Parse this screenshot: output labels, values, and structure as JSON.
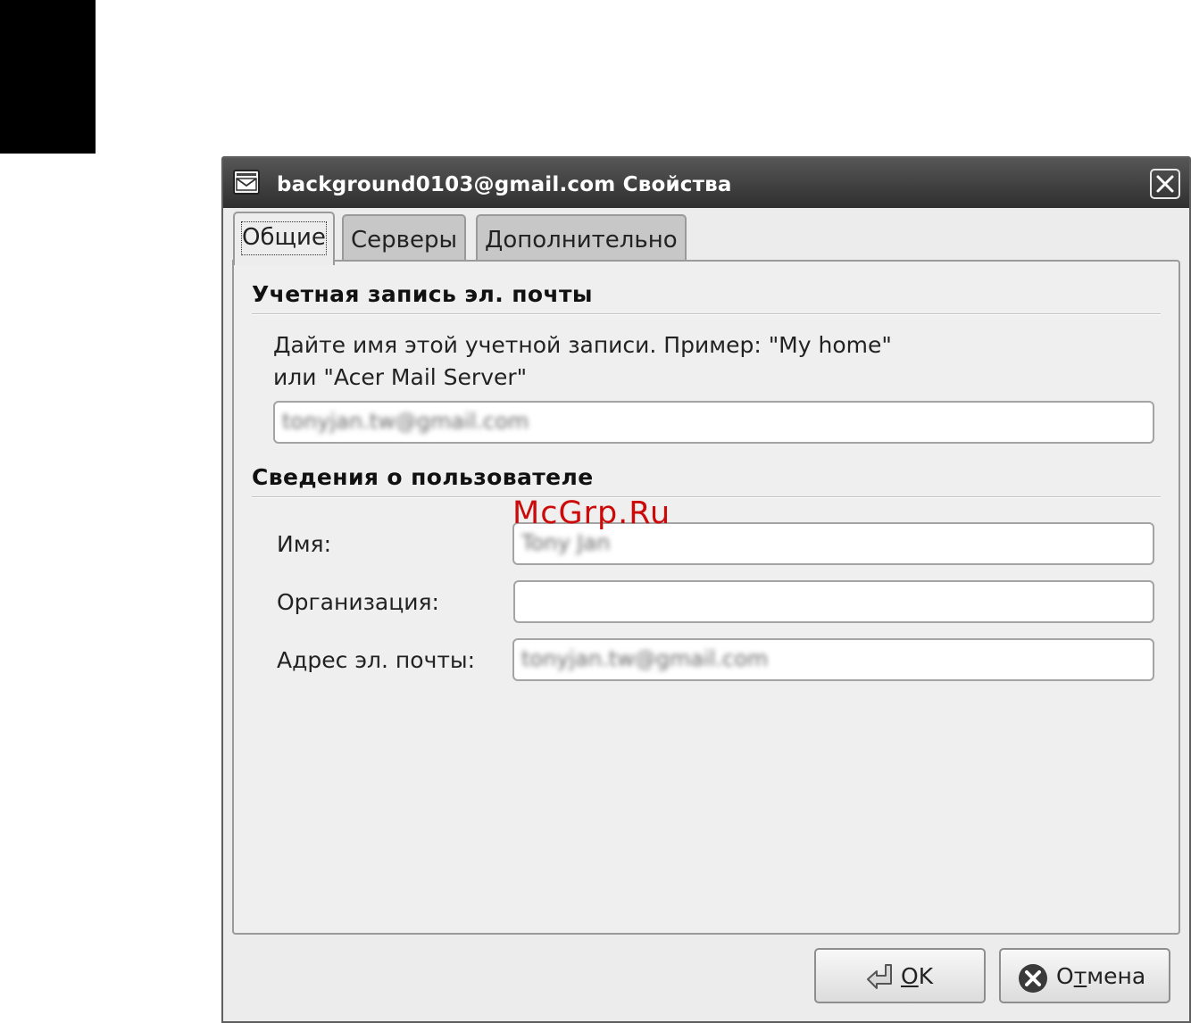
{
  "window": {
    "title": "background0103@gmail.com Свойства",
    "app_icon": "mail-envelope-icon",
    "close_icon": "close-icon"
  },
  "tabs": [
    {
      "label": "Общие",
      "active": true
    },
    {
      "label": "Серверы",
      "active": false
    },
    {
      "label": "Дополнительно",
      "active": false
    }
  ],
  "account_section": {
    "title": "Учетная запись эл. почты",
    "description": "Дайте имя этой учетной записи. Пример: \"My home\" или \"Acer Mail Server\"",
    "name_value": "tonyjan.tw@gmail.com"
  },
  "user_section": {
    "title": "Сведения о пользователе",
    "name_label": "Имя:",
    "name_value": "Tony Jan",
    "org_label": "Организация:",
    "org_value": "",
    "email_label": "Адрес эл. почты:",
    "email_value": "tonyjan.tw@gmail.com"
  },
  "watermark": "McGrp.Ru",
  "buttons": {
    "ok": {
      "mnemonic": "O",
      "rest": "K",
      "icon": "ok-arrow-icon"
    },
    "cancel": {
      "pre": "О",
      "mnemonic": "т",
      "rest": "мена",
      "icon": "cancel-x-icon"
    }
  }
}
